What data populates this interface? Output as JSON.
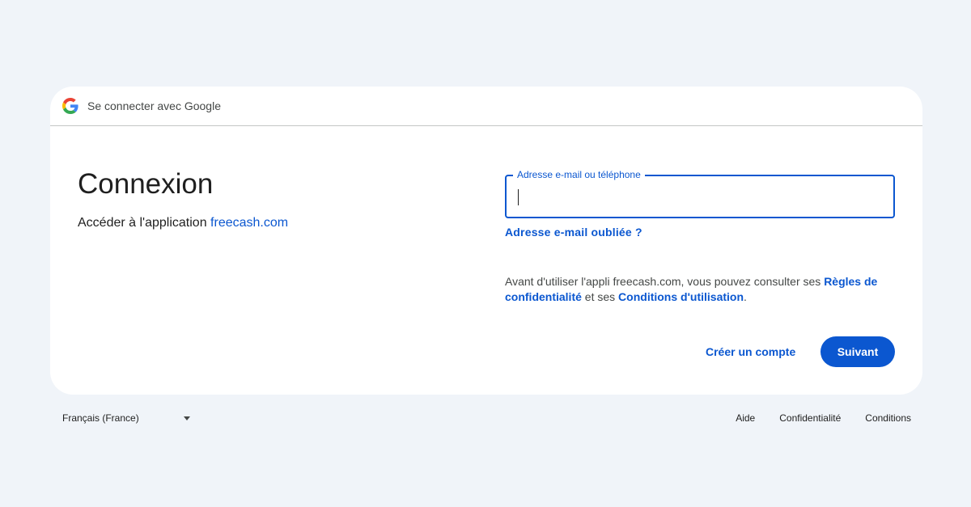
{
  "header": {
    "title": "Se connecter avec Google"
  },
  "main": {
    "title": "Connexion",
    "subtitle_prefix": "Accéder à l'application ",
    "subtitle_app": "freecash.com"
  },
  "form": {
    "email_label": "Adresse e-mail ou téléphone",
    "email_value": "",
    "forgot_link": "Adresse e-mail oubliée ?",
    "policy_prefix": "Avant d'utiliser l'appli freecash.com, vous pouvez consulter ses ",
    "privacy_link": "Règles de confidentialité",
    "policy_middle": " et ses ",
    "terms_link": "Conditions d'utilisation",
    "policy_suffix": ".",
    "create_account": "Créer un compte",
    "next_button": "Suivant"
  },
  "footer": {
    "language": "Français (France)",
    "links": [
      "Aide",
      "Confidentialité",
      "Conditions"
    ]
  },
  "colors": {
    "accent": "#0b57d0",
    "background": "#f0f4f9",
    "card": "#ffffff"
  }
}
